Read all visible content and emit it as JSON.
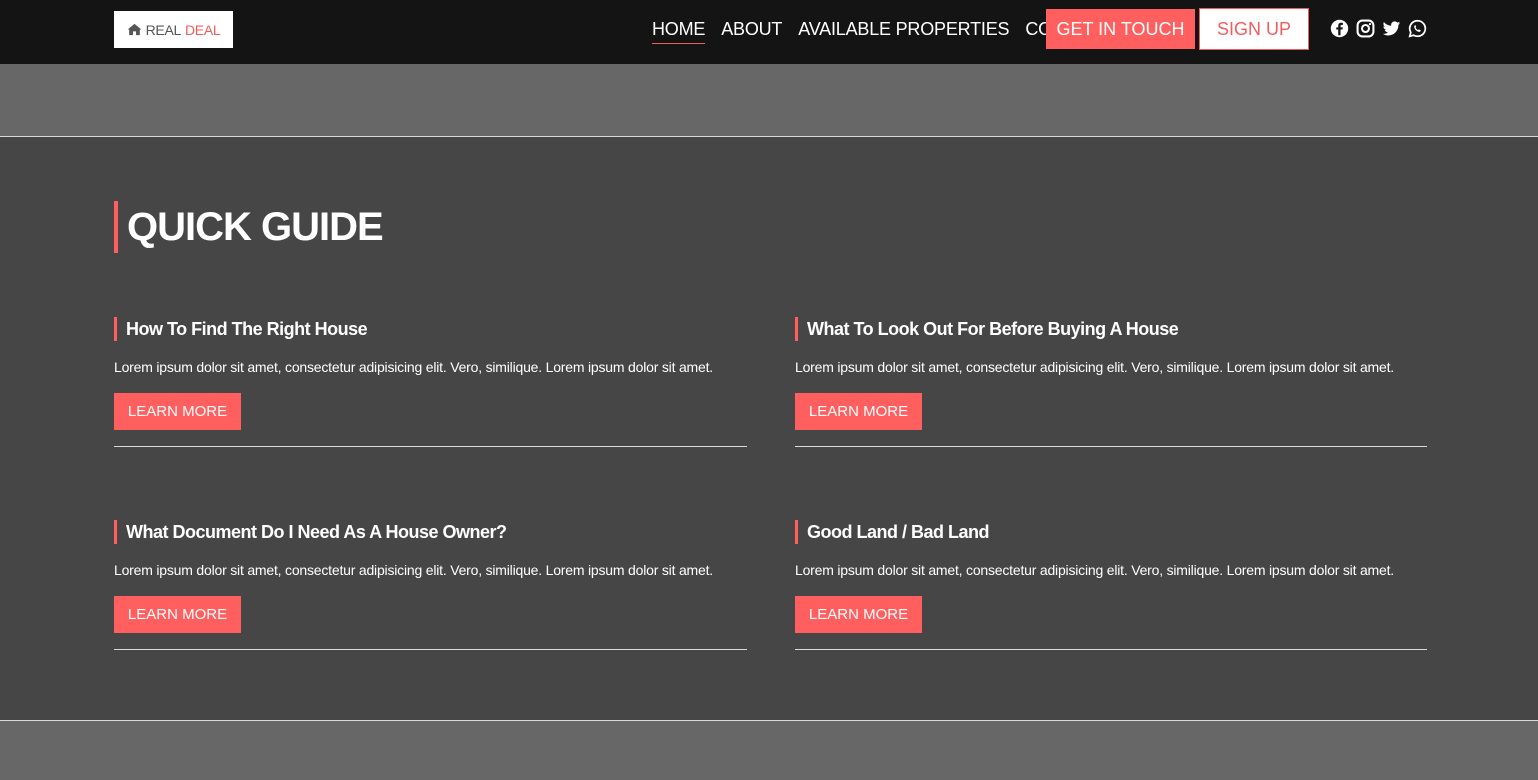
{
  "header": {
    "logo": {
      "word1": "REAL",
      "word2": "DEAL",
      "icon": "home-icon"
    },
    "nav": [
      {
        "label": "HOME",
        "active": true
      },
      {
        "label": "ABOUT",
        "active": false
      },
      {
        "label": "AVAILABLE PROPERTIES",
        "active": false
      },
      {
        "label": "CONTACT",
        "active": false
      }
    ],
    "cta_label": "GET IN TOUCH",
    "signup_label": "SIGN UP",
    "socials": [
      "facebook-icon",
      "instagram-icon",
      "twitter-icon",
      "whatsapp-icon"
    ]
  },
  "quick_guide": {
    "title": "QUICK GUIDE",
    "cards": [
      {
        "title": "How To Find The Right House",
        "text": "Lorem ipsum dolor sit amet, consectetur adipisicing elit. Vero, similique. Lorem ipsum dolor sit amet.",
        "button": "LEARN MORE"
      },
      {
        "title": "What To Look Out For Before Buying A House",
        "text": "Lorem ipsum dolor sit amet, consectetur adipisicing elit. Vero, similique. Lorem ipsum dolor sit amet.",
        "button": "LEARN MORE"
      },
      {
        "title": "What Document Do I Need As A House Owner?",
        "text": "Lorem ipsum dolor sit amet, consectetur adipisicing elit. Vero, similique. Lorem ipsum dolor sit amet.",
        "button": "LEARN MORE"
      },
      {
        "title": "Good Land / Bad Land",
        "text": "Lorem ipsum dolor sit amet, consectetur adipisicing elit. Vero, similique. Lorem ipsum dolor sit amet.",
        "button": "LEARN MORE"
      }
    ]
  },
  "colors": {
    "accent": "#ff5f5f",
    "navbar": "#141414",
    "section": "#464646",
    "band": "#676767"
  }
}
